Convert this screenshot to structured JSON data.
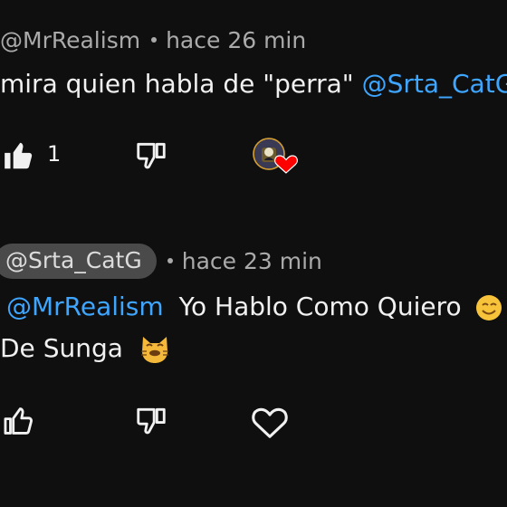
{
  "comments": [
    {
      "author": "@MrRealism",
      "time": "hace 26 min",
      "text": "mira quien habla de \"perra\"",
      "mention": "@Srta_CatG",
      "likes": "1",
      "liked": true,
      "creator_hearted": true
    },
    {
      "author": "@Srta_CatG",
      "time": "hace 23 min",
      "mention": "@MrRealism",
      "text_line1": "Yo Hablo Como Quiero",
      "text_line2": "De Sunga",
      "likes": "",
      "liked": false,
      "creator_hearted": false
    }
  ],
  "icons": {
    "like": "thumbs-up-icon",
    "dislike": "thumbs-down-icon",
    "heart": "heart-icon"
  },
  "colors": {
    "background": "#0f0f0f",
    "mention": "#3ea6ff",
    "meta": "#aaaaaa",
    "chip": "#4a4a4a",
    "heart_red": "#ff0000"
  }
}
